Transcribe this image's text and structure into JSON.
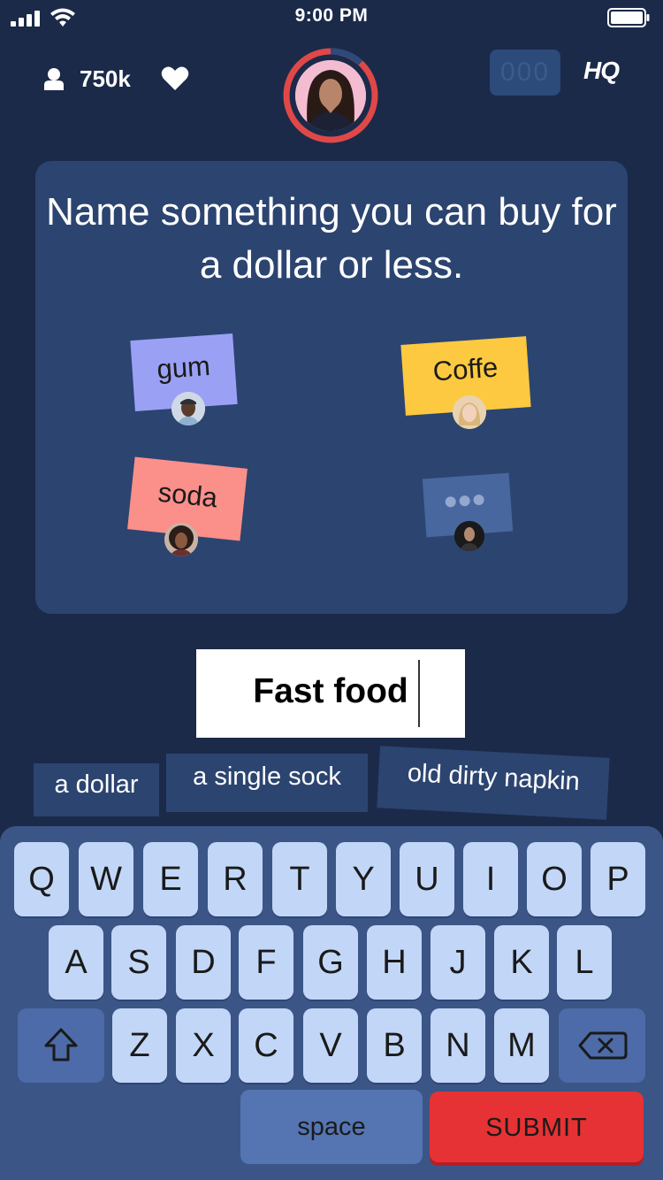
{
  "status_bar": {
    "time": "9:00 PM"
  },
  "header": {
    "player_count": "750k",
    "score_display": "000",
    "logo": "HQ"
  },
  "question": {
    "text": "Name something you can buy for a dollar or less."
  },
  "answers": [
    {
      "text": "gum",
      "color": "#9aa1f5"
    },
    {
      "text": "Coffe",
      "color": "#fcc940"
    },
    {
      "text": "soda",
      "color": "#fb8f8a"
    },
    {
      "text": "",
      "color": "#48679f",
      "typing": true
    }
  ],
  "input": {
    "value": "Fast food"
  },
  "suggestions": [
    "a dollar",
    "a single sock",
    "old dirty napkin"
  ],
  "keyboard": {
    "row1": [
      "Q",
      "W",
      "E",
      "R",
      "T",
      "Y",
      "U",
      "I",
      "O",
      "P"
    ],
    "row2": [
      "A",
      "S",
      "D",
      "F",
      "G",
      "H",
      "J",
      "K",
      "L"
    ],
    "row3": [
      "Z",
      "X",
      "C",
      "V",
      "B",
      "N",
      "M"
    ],
    "space_label": "space",
    "submit_label": "SUBMIT",
    "shift_icon": "shift-icon",
    "backspace_icon": "backspace-icon"
  },
  "colors": {
    "background": "#1b2a49",
    "card": "#2c4470",
    "host_ring": "#e04848",
    "submit": "#e63234",
    "key": "#c2d7f7"
  }
}
